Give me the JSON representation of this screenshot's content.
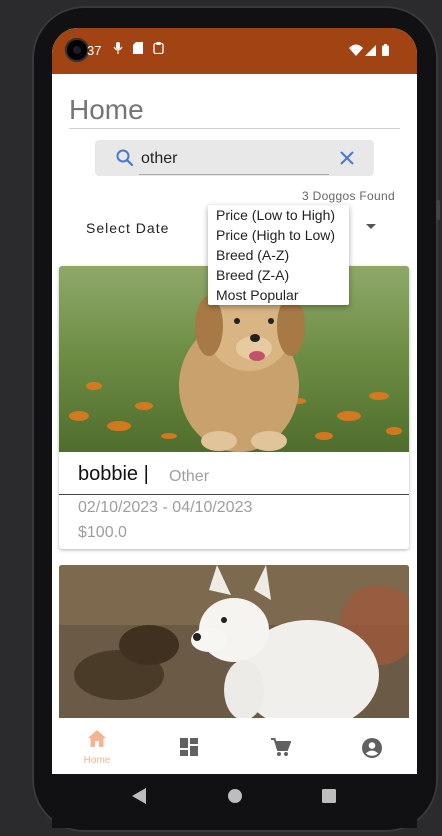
{
  "status_bar": {
    "time": "37"
  },
  "page": {
    "title": "Home"
  },
  "search": {
    "value": "other"
  },
  "results": {
    "count_text": "3 Doggos Found"
  },
  "filters": {
    "select_date_label": "Select Date"
  },
  "sort_menu": {
    "items": [
      "Price (Low to High)",
      "Price (High to Low)",
      "Breed (A-Z)",
      "Breed (Z-A)",
      "Most Popular"
    ]
  },
  "cards": [
    {
      "name": "bobbie |",
      "breed": "Other",
      "dates": "02/10/2023 - 04/10/2023",
      "price": "$100.0"
    }
  ],
  "bottom_nav": {
    "home_label": "Home",
    "active": "home",
    "active_color": "#f3b48f",
    "inactive_color": "#616161"
  },
  "colors": {
    "status_bar": "#a14312",
    "accent_search": "#4a78d1"
  }
}
